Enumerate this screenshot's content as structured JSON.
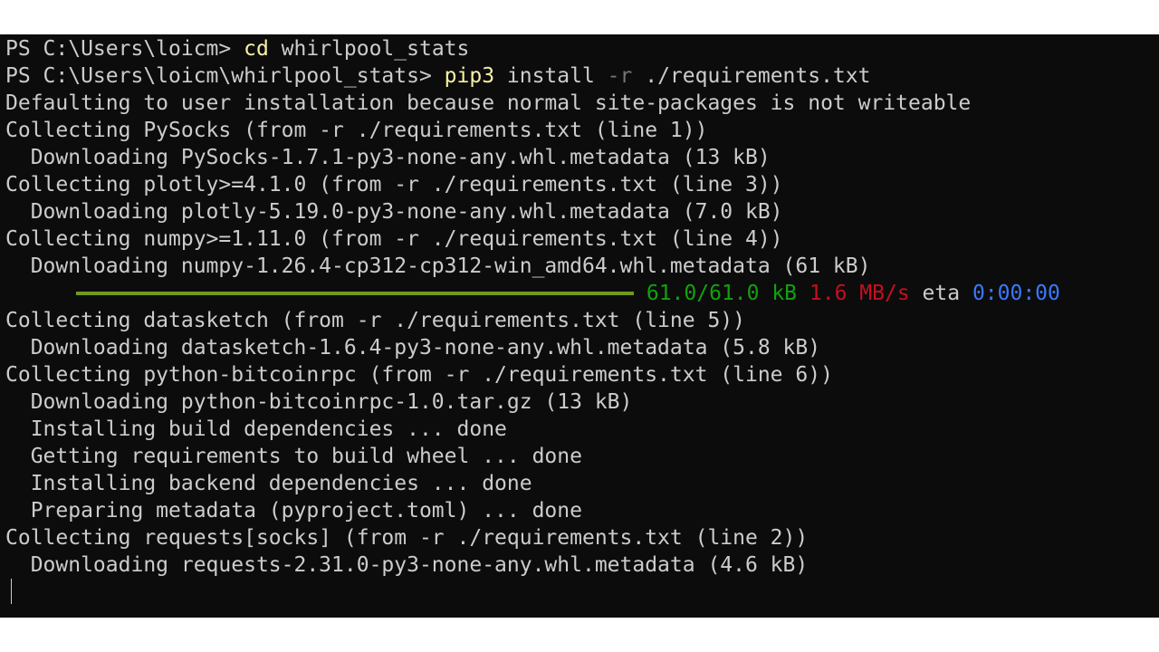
{
  "terminal": {
    "line_01": {
      "prompt": "PS C:\\Users\\loicm> ",
      "command": "cd",
      "args": " whirlpool_stats"
    },
    "line_02": {
      "prompt": "PS C:\\Users\\loicm\\whirlpool_stats> ",
      "command": "pip3",
      "args_1": " install ",
      "flag": "-r",
      "args_2": " ./requirements.txt"
    },
    "line_03": "Defaulting to user installation because normal site-packages is not writeable",
    "line_04": "Collecting PySocks (from -r ./requirements.txt (line 1))",
    "line_05": "  Downloading PySocks-1.7.1-py3-none-any.whl.metadata (13 kB)",
    "line_06": "Collecting plotly>=4.1.0 (from -r ./requirements.txt (line 3))",
    "line_07": "  Downloading plotly-5.19.0-py3-none-any.whl.metadata (7.0 kB)",
    "line_08": "Collecting numpy>=1.11.0 (from -r ./requirements.txt (line 4))",
    "line_09": "  Downloading numpy-1.26.4-cp312-cp312-win_amd64.whl.metadata (61 kB)",
    "progress": {
      "fraction": 1.0,
      "size": "61.0/61.0 kB",
      "speed": "1.6 MB/s",
      "eta_label": "eta",
      "eta_value": "0:00:00",
      "bar_color": "#6f9a1e"
    },
    "line_11": "Collecting datasketch (from -r ./requirements.txt (line 5))",
    "line_12": "  Downloading datasketch-1.6.4-py3-none-any.whl.metadata (5.8 kB)",
    "line_13": "Collecting python-bitcoinrpc (from -r ./requirements.txt (line 6))",
    "line_14": "  Downloading python-bitcoinrpc-1.0.tar.gz (13 kB)",
    "line_15": "  Installing build dependencies ... done",
    "line_16": "  Getting requirements to build wheel ... done",
    "line_17": "  Installing backend dependencies ... done",
    "line_18": "  Preparing metadata (pyproject.toml) ... done",
    "line_19": "Collecting requests[socks] (from -r ./requirements.txt (line 2))",
    "line_20": "  Downloading requests-2.31.0-py3-none-any.whl.metadata (4.6 kB)",
    "colors": {
      "background": "#0c0c0c",
      "foreground": "#cccccc",
      "command": "#f9f1a5",
      "flag": "#767676",
      "size": "#13a10e",
      "speed": "#c50f1f",
      "eta": "#3b78ff"
    }
  }
}
